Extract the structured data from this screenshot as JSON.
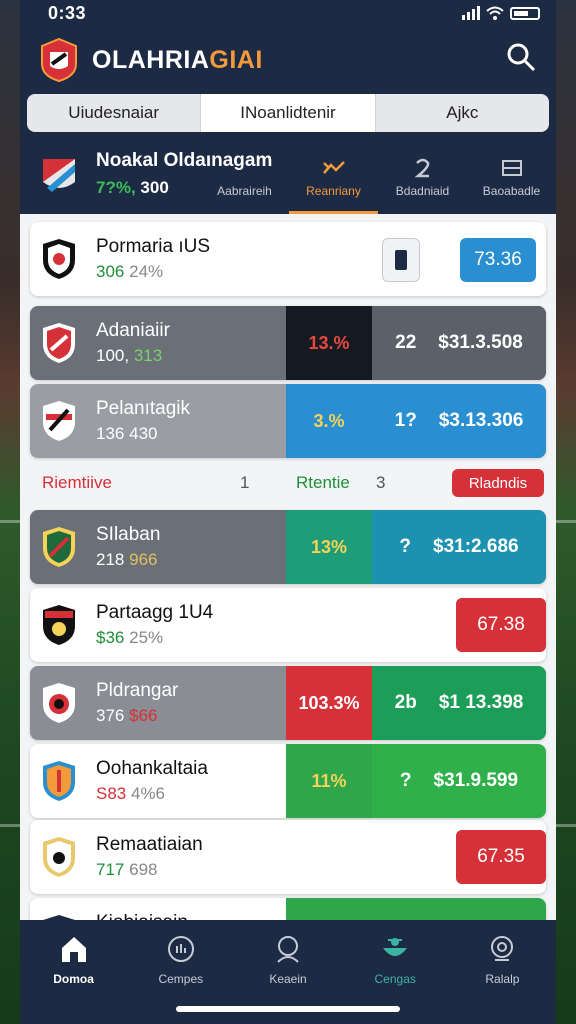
{
  "status_bar": {
    "time": "0:33"
  },
  "app": {
    "title_main": "OLAHRIA",
    "title_accent": "GIAI"
  },
  "segments": [
    "Uiudesnaiar",
    "INoanlidtenir",
    "Ajkc"
  ],
  "match_header": {
    "title": "Noakal Oldaınagam",
    "odds_green": "7?%,",
    "odds_white": "300",
    "tabs": [
      {
        "label": "Aabraireih",
        "icon": "chart-icon"
      },
      {
        "label": "Reanriany",
        "icon": "trend-icon"
      },
      {
        "label": "Bdadniaid",
        "icon": "number-icon"
      },
      {
        "label": "Baoabadle",
        "icon": "card-icon"
      }
    ]
  },
  "rows": [
    {
      "name": "Pormaria ıUS",
      "sub_a": "306",
      "sub_b": "24%",
      "price": "73.36"
    },
    {
      "name": "Adaniaiir",
      "sub_a": "100,",
      "sub_b": "313",
      "pct": "13.%",
      "num": "22",
      "value": "$31.3.508"
    },
    {
      "name": "Pelanıtagik",
      "sub_a": "136",
      "sub_b": "430",
      "pct": "3.%",
      "num": "1?",
      "value": "$3.13.306"
    },
    {
      "name": "SIlaban",
      "sub_a": "218",
      "sub_b": "966",
      "pct": "13%",
      "num": "?",
      "value": "$31:2.686"
    },
    {
      "name": "Partaagg 1U4",
      "sub_a": "$36",
      "sub_b": "25%",
      "price": "67.38"
    },
    {
      "name": "Pldrangar",
      "sub_a": "376",
      "sub_b": "$66",
      "pct": "103.3%",
      "num": "2b",
      "value": "$1 13.398"
    },
    {
      "name": "Oohankaltaia",
      "sub_a": "S83",
      "sub_b": "4%6",
      "pct": "11%",
      "num": "?",
      "value": "$31.9.599"
    },
    {
      "name": "Remaatiaian",
      "sub_a": "717",
      "sub_b": "698",
      "price": "67.35"
    },
    {
      "name": "Kiobiaisain"
    }
  ],
  "section": {
    "left_label": "Riemtiive",
    "left_num": "1",
    "mid_label": "Rtentie",
    "mid_num": "3",
    "pill": "Rladndis"
  },
  "nav": [
    {
      "label": "Domoa",
      "icon": "home-icon"
    },
    {
      "label": "Cempes",
      "icon": "stats-icon"
    },
    {
      "label": "Keaein",
      "icon": "profile-icon"
    },
    {
      "label": "Cengas",
      "icon": "bet-icon"
    },
    {
      "label": "Ralalp",
      "icon": "support-icon"
    }
  ],
  "colors": {
    "header": "#1d2a44",
    "accent": "#f39a3a",
    "blue": "#2a8fd0",
    "green": "#2fa64a",
    "red": "#d63038",
    "teal": "#1d9e78"
  }
}
